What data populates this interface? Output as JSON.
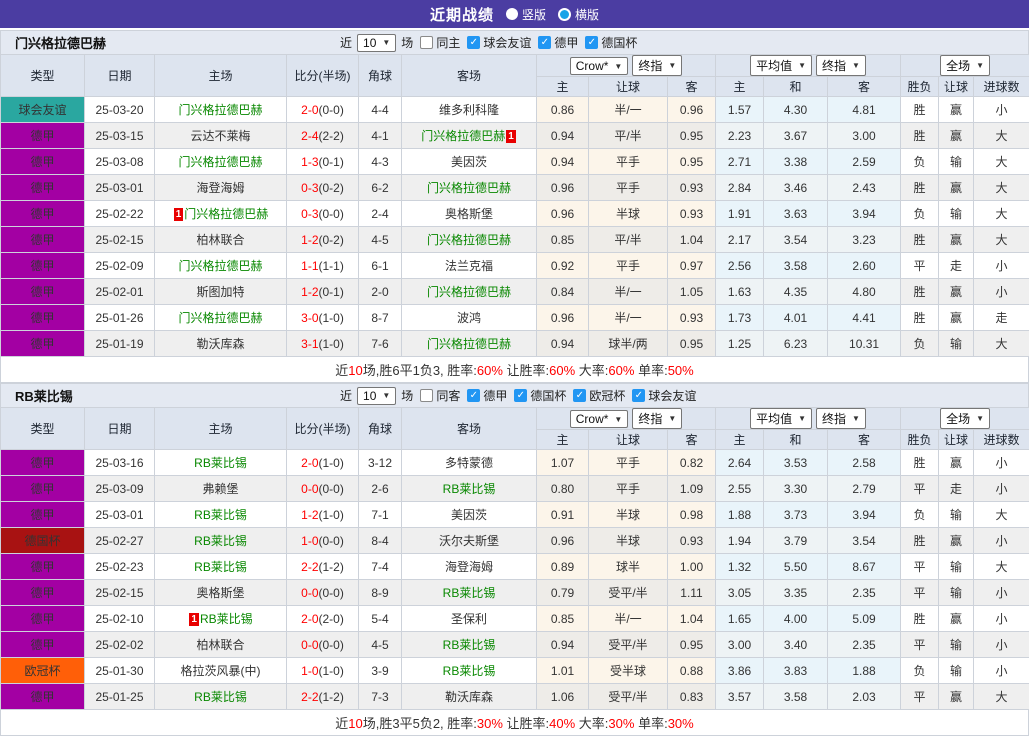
{
  "titlebar": {
    "title": "近期战绩",
    "options": [
      {
        "label": "竖版",
        "selected": false
      },
      {
        "label": "横版",
        "selected": true
      }
    ]
  },
  "colors": {
    "titlebar_bg": "#4b3da2",
    "table_header_bg": "#dde4ef",
    "section_header_bg": "#e4e9f2",
    "type_colors": {
      "球会友谊": "#2aa7a0",
      "德甲": "#a300a3",
      "德国杯": "#a81212",
      "欧冠杯": "#ff5f08"
    },
    "team_link_green": "#088800",
    "score_red": "#ff0000",
    "result_red": "#e02222",
    "result_blue": "#2424cc",
    "result_green": "#0a9a32",
    "odds_col_bg": "#fcf5ea",
    "avg_col_bg": "#e9f4fa",
    "checkbox_on": "#2196f3",
    "radio_selected": "#18a3e8",
    "red_card_badge": "#e80000"
  },
  "header": {
    "left_cols": [
      "类型",
      "日期",
      "主场",
      "比分(半场)",
      "角球",
      "客场"
    ],
    "group_selects": [
      [
        "Crow*",
        "终指"
      ],
      [
        "平均值",
        "终指"
      ],
      [
        "全场"
      ]
    ],
    "sub_cols": [
      "主",
      "让球",
      "客",
      "主",
      "和",
      "客",
      "胜负",
      "让球",
      "进球数"
    ]
  },
  "sections": [
    {
      "team": "门兴格拉德巴赫",
      "filters": {
        "near": "近",
        "count": "10",
        "games": "场",
        "venue": {
          "label": "同主",
          "checked": false
        },
        "comps": [
          {
            "label": "球会友谊",
            "checked": true
          },
          {
            "label": "德甲",
            "checked": true
          },
          {
            "label": "德国杯",
            "checked": true
          }
        ]
      },
      "rows": [
        {
          "type": "球会友谊",
          "date": "25-03-20",
          "home": {
            "name": "门兴格拉德巴赫",
            "team": true
          },
          "score": "2-0",
          "half": "(0-0)",
          "corner": "4-4",
          "away": {
            "name": "维多利科隆",
            "team": false
          },
          "odds": [
            "0.86",
            "半/一",
            "0.96"
          ],
          "avg": [
            "1.57",
            "4.30",
            "4.81"
          ],
          "result": [
            {
              "t": "胜",
              "c": "red"
            },
            {
              "t": "赢",
              "c": "red"
            },
            {
              "t": "小",
              "c": "blue"
            }
          ]
        },
        {
          "type": "德甲",
          "date": "25-03-15",
          "home": {
            "name": "云达不莱梅",
            "team": false
          },
          "score": "2-4",
          "half": "(2-2)",
          "corner": "4-1",
          "away": {
            "name": "门兴格拉德巴赫",
            "team": true,
            "rc": "after"
          },
          "odds": [
            "0.94",
            "平/半",
            "0.95"
          ],
          "avg": [
            "2.23",
            "3.67",
            "3.00"
          ],
          "result": [
            {
              "t": "胜",
              "c": "red"
            },
            {
              "t": "赢",
              "c": "red"
            },
            {
              "t": "大",
              "c": "red"
            }
          ]
        },
        {
          "type": "德甲",
          "date": "25-03-08",
          "home": {
            "name": "门兴格拉德巴赫",
            "team": true
          },
          "score": "1-3",
          "half": "(0-1)",
          "corner": "4-3",
          "away": {
            "name": "美因茨",
            "team": false
          },
          "odds": [
            "0.94",
            "平手",
            "0.95"
          ],
          "avg": [
            "2.71",
            "3.38",
            "2.59"
          ],
          "result": [
            {
              "t": "负",
              "c": "blue"
            },
            {
              "t": "输",
              "c": "blue"
            },
            {
              "t": "大",
              "c": "red"
            }
          ]
        },
        {
          "type": "德甲",
          "date": "25-03-01",
          "home": {
            "name": "海登海姆",
            "team": false
          },
          "score": "0-3",
          "half": "(0-2)",
          "corner": "6-2",
          "away": {
            "name": "门兴格拉德巴赫",
            "team": true
          },
          "odds": [
            "0.96",
            "平手",
            "0.93"
          ],
          "avg": [
            "2.84",
            "3.46",
            "2.43"
          ],
          "result": [
            {
              "t": "胜",
              "c": "red"
            },
            {
              "t": "赢",
              "c": "red"
            },
            {
              "t": "大",
              "c": "red"
            }
          ]
        },
        {
          "type": "德甲",
          "date": "25-02-22",
          "home": {
            "name": "门兴格拉德巴赫",
            "team": true,
            "rc": "before"
          },
          "score": "0-3",
          "half": "(0-0)",
          "corner": "2-4",
          "away": {
            "name": "奥格斯堡",
            "team": false
          },
          "odds": [
            "0.96",
            "半球",
            "0.93"
          ],
          "avg": [
            "1.91",
            "3.63",
            "3.94"
          ],
          "result": [
            {
              "t": "负",
              "c": "blue"
            },
            {
              "t": "输",
              "c": "blue"
            },
            {
              "t": "大",
              "c": "red"
            }
          ]
        },
        {
          "type": "德甲",
          "date": "25-02-15",
          "home": {
            "name": "柏林联合",
            "team": false
          },
          "score": "1-2",
          "half": "(0-2)",
          "corner": "4-5",
          "away": {
            "name": "门兴格拉德巴赫",
            "team": true
          },
          "odds": [
            "0.85",
            "平/半",
            "1.04"
          ],
          "avg": [
            "2.17",
            "3.54",
            "3.23"
          ],
          "result": [
            {
              "t": "胜",
              "c": "red"
            },
            {
              "t": "赢",
              "c": "red"
            },
            {
              "t": "大",
              "c": "red"
            }
          ]
        },
        {
          "type": "德甲",
          "date": "25-02-09",
          "home": {
            "name": "门兴格拉德巴赫",
            "team": true
          },
          "score": "1-1",
          "half": "(1-1)",
          "corner": "6-1",
          "away": {
            "name": "法兰克福",
            "team": false
          },
          "odds": [
            "0.92",
            "平手",
            "0.97"
          ],
          "avg": [
            "2.56",
            "3.58",
            "2.60"
          ],
          "result": [
            {
              "t": "平",
              "c": "green"
            },
            {
              "t": "走",
              "c": "green"
            },
            {
              "t": "小",
              "c": "blue"
            }
          ]
        },
        {
          "type": "德甲",
          "date": "25-02-01",
          "home": {
            "name": "斯图加特",
            "team": false
          },
          "score": "1-2",
          "half": "(0-1)",
          "corner": "2-0",
          "away": {
            "name": "门兴格拉德巴赫",
            "team": true
          },
          "odds": [
            "0.84",
            "半/一",
            "1.05"
          ],
          "avg": [
            "1.63",
            "4.35",
            "4.80"
          ],
          "result": [
            {
              "t": "胜",
              "c": "red"
            },
            {
              "t": "赢",
              "c": "red"
            },
            {
              "t": "小",
              "c": "blue"
            }
          ]
        },
        {
          "type": "德甲",
          "date": "25-01-26",
          "home": {
            "name": "门兴格拉德巴赫",
            "team": true
          },
          "score": "3-0",
          "half": "(1-0)",
          "corner": "8-7",
          "away": {
            "name": "波鸿",
            "team": false
          },
          "odds": [
            "0.96",
            "半/一",
            "0.93"
          ],
          "avg": [
            "1.73",
            "4.01",
            "4.41"
          ],
          "result": [
            {
              "t": "胜",
              "c": "red"
            },
            {
              "t": "赢",
              "c": "red"
            },
            {
              "t": "走",
              "c": "green"
            }
          ]
        },
        {
          "type": "德甲",
          "date": "25-01-19",
          "home": {
            "name": "勒沃库森",
            "team": false
          },
          "score": "3-1",
          "half": "(1-0)",
          "corner": "7-6",
          "away": {
            "name": "门兴格拉德巴赫",
            "team": true
          },
          "odds": [
            "0.94",
            "球半/两",
            "0.95"
          ],
          "avg": [
            "1.25",
            "6.23",
            "10.31"
          ],
          "result": [
            {
              "t": "负",
              "c": "blue"
            },
            {
              "t": "输",
              "c": "blue"
            },
            {
              "t": "大",
              "c": "red"
            }
          ]
        }
      ],
      "summary": [
        {
          "t": "近"
        },
        {
          "t": "10",
          "red": true
        },
        {
          "t": "场,胜6平1负3, 胜率:"
        },
        {
          "t": "60%",
          "red": true
        },
        {
          "t": " 让胜率:"
        },
        {
          "t": "60%",
          "red": true
        },
        {
          "t": " 大率:"
        },
        {
          "t": "60%",
          "red": true
        },
        {
          "t": " 单率:"
        },
        {
          "t": "50%",
          "red": true
        }
      ]
    },
    {
      "team": "RB莱比锡",
      "filters": {
        "near": "近",
        "count": "10",
        "games": "场",
        "venue": {
          "label": "同客",
          "checked": false
        },
        "comps": [
          {
            "label": "德甲",
            "checked": true
          },
          {
            "label": "德国杯",
            "checked": true
          },
          {
            "label": "欧冠杯",
            "checked": true
          },
          {
            "label": "球会友谊",
            "checked": true
          }
        ]
      },
      "rows": [
        {
          "type": "德甲",
          "date": "25-03-16",
          "home": {
            "name": "RB莱比锡",
            "team": true
          },
          "score": "2-0",
          "half": "(1-0)",
          "corner": "3-12",
          "away": {
            "name": "多特蒙德",
            "team": false
          },
          "odds": [
            "1.07",
            "平手",
            "0.82"
          ],
          "avg": [
            "2.64",
            "3.53",
            "2.58"
          ],
          "result": [
            {
              "t": "胜",
              "c": "red"
            },
            {
              "t": "赢",
              "c": "red"
            },
            {
              "t": "小",
              "c": "blue"
            }
          ]
        },
        {
          "type": "德甲",
          "date": "25-03-09",
          "home": {
            "name": "弗赖堡",
            "team": false
          },
          "score": "0-0",
          "half": "(0-0)",
          "corner": "2-6",
          "away": {
            "name": "RB莱比锡",
            "team": true
          },
          "odds": [
            "0.80",
            "平手",
            "1.09"
          ],
          "avg": [
            "2.55",
            "3.30",
            "2.79"
          ],
          "result": [
            {
              "t": "平",
              "c": "green"
            },
            {
              "t": "走",
              "c": "green"
            },
            {
              "t": "小",
              "c": "blue"
            }
          ]
        },
        {
          "type": "德甲",
          "date": "25-03-01",
          "home": {
            "name": "RB莱比锡",
            "team": true
          },
          "score": "1-2",
          "half": "(1-0)",
          "corner": "7-1",
          "away": {
            "name": "美因茨",
            "team": false
          },
          "odds": [
            "0.91",
            "半球",
            "0.98"
          ],
          "avg": [
            "1.88",
            "3.73",
            "3.94"
          ],
          "result": [
            {
              "t": "负",
              "c": "blue"
            },
            {
              "t": "输",
              "c": "blue"
            },
            {
              "t": "大",
              "c": "red"
            }
          ]
        },
        {
          "type": "德国杯",
          "date": "25-02-27",
          "home": {
            "name": "RB莱比锡",
            "team": true
          },
          "score": "1-0",
          "half": "(0-0)",
          "corner": "8-4",
          "away": {
            "name": "沃尔夫斯堡",
            "team": false
          },
          "odds": [
            "0.96",
            "半球",
            "0.93"
          ],
          "avg": [
            "1.94",
            "3.79",
            "3.54"
          ],
          "result": [
            {
              "t": "胜",
              "c": "red"
            },
            {
              "t": "赢",
              "c": "red"
            },
            {
              "t": "小",
              "c": "blue"
            }
          ]
        },
        {
          "type": "德甲",
          "date": "25-02-23",
          "home": {
            "name": "RB莱比锡",
            "team": true
          },
          "score": "2-2",
          "half": "(1-2)",
          "corner": "7-4",
          "away": {
            "name": "海登海姆",
            "team": false
          },
          "odds": [
            "0.89",
            "球半",
            "1.00"
          ],
          "avg": [
            "1.32",
            "5.50",
            "8.67"
          ],
          "result": [
            {
              "t": "平",
              "c": "green"
            },
            {
              "t": "输",
              "c": "blue"
            },
            {
              "t": "大",
              "c": "red"
            }
          ]
        },
        {
          "type": "德甲",
          "date": "25-02-15",
          "home": {
            "name": "奥格斯堡",
            "team": false
          },
          "score": "0-0",
          "half": "(0-0)",
          "corner": "8-9",
          "away": {
            "name": "RB莱比锡",
            "team": true
          },
          "odds": [
            "0.79",
            "受平/半",
            "1.11"
          ],
          "avg": [
            "3.05",
            "3.35",
            "2.35"
          ],
          "result": [
            {
              "t": "平",
              "c": "green"
            },
            {
              "t": "输",
              "c": "blue"
            },
            {
              "t": "小",
              "c": "blue"
            }
          ]
        },
        {
          "type": "德甲",
          "date": "25-02-10",
          "home": {
            "name": "RB莱比锡",
            "team": true,
            "rc": "before"
          },
          "score": "2-0",
          "half": "(2-0)",
          "corner": "5-4",
          "away": {
            "name": "圣保利",
            "team": false
          },
          "odds": [
            "0.85",
            "半/一",
            "1.04"
          ],
          "avg": [
            "1.65",
            "4.00",
            "5.09"
          ],
          "result": [
            {
              "t": "胜",
              "c": "red"
            },
            {
              "t": "赢",
              "c": "red"
            },
            {
              "t": "小",
              "c": "blue"
            }
          ]
        },
        {
          "type": "德甲",
          "date": "25-02-02",
          "home": {
            "name": "柏林联合",
            "team": false
          },
          "score": "0-0",
          "half": "(0-0)",
          "corner": "4-5",
          "away": {
            "name": "RB莱比锡",
            "team": true
          },
          "odds": [
            "0.94",
            "受平/半",
            "0.95"
          ],
          "avg": [
            "3.00",
            "3.40",
            "2.35"
          ],
          "result": [
            {
              "t": "平",
              "c": "green"
            },
            {
              "t": "输",
              "c": "blue"
            },
            {
              "t": "小",
              "c": "blue"
            }
          ]
        },
        {
          "type": "欧冠杯",
          "date": "25-01-30",
          "home": {
            "name": "格拉茨风暴(中)",
            "team": false
          },
          "score": "1-0",
          "half": "(1-0)",
          "corner": "3-9",
          "away": {
            "name": "RB莱比锡",
            "team": true
          },
          "odds": [
            "1.01",
            "受半球",
            "0.88"
          ],
          "avg": [
            "3.86",
            "3.83",
            "1.88"
          ],
          "result": [
            {
              "t": "负",
              "c": "blue"
            },
            {
              "t": "输",
              "c": "blue"
            },
            {
              "t": "小",
              "c": "blue"
            }
          ]
        },
        {
          "type": "德甲",
          "date": "25-01-25",
          "home": {
            "name": "RB莱比锡",
            "team": true
          },
          "score": "2-2",
          "half": "(1-2)",
          "corner": "7-3",
          "away": {
            "name": "勒沃库森",
            "team": false
          },
          "odds": [
            "1.06",
            "受平/半",
            "0.83"
          ],
          "avg": [
            "3.57",
            "3.58",
            "2.03"
          ],
          "result": [
            {
              "t": "平",
              "c": "green"
            },
            {
              "t": "赢",
              "c": "red"
            },
            {
              "t": "大",
              "c": "red"
            }
          ]
        }
      ],
      "summary": [
        {
          "t": "近"
        },
        {
          "t": "10",
          "red": true
        },
        {
          "t": "场,胜3平5负2, 胜率:"
        },
        {
          "t": "30%",
          "red": true
        },
        {
          "t": " 让胜率:"
        },
        {
          "t": "40%",
          "red": true
        },
        {
          "t": " 大率:"
        },
        {
          "t": "30%",
          "red": true
        },
        {
          "t": " 单率:"
        },
        {
          "t": "30%",
          "red": true
        }
      ]
    }
  ]
}
